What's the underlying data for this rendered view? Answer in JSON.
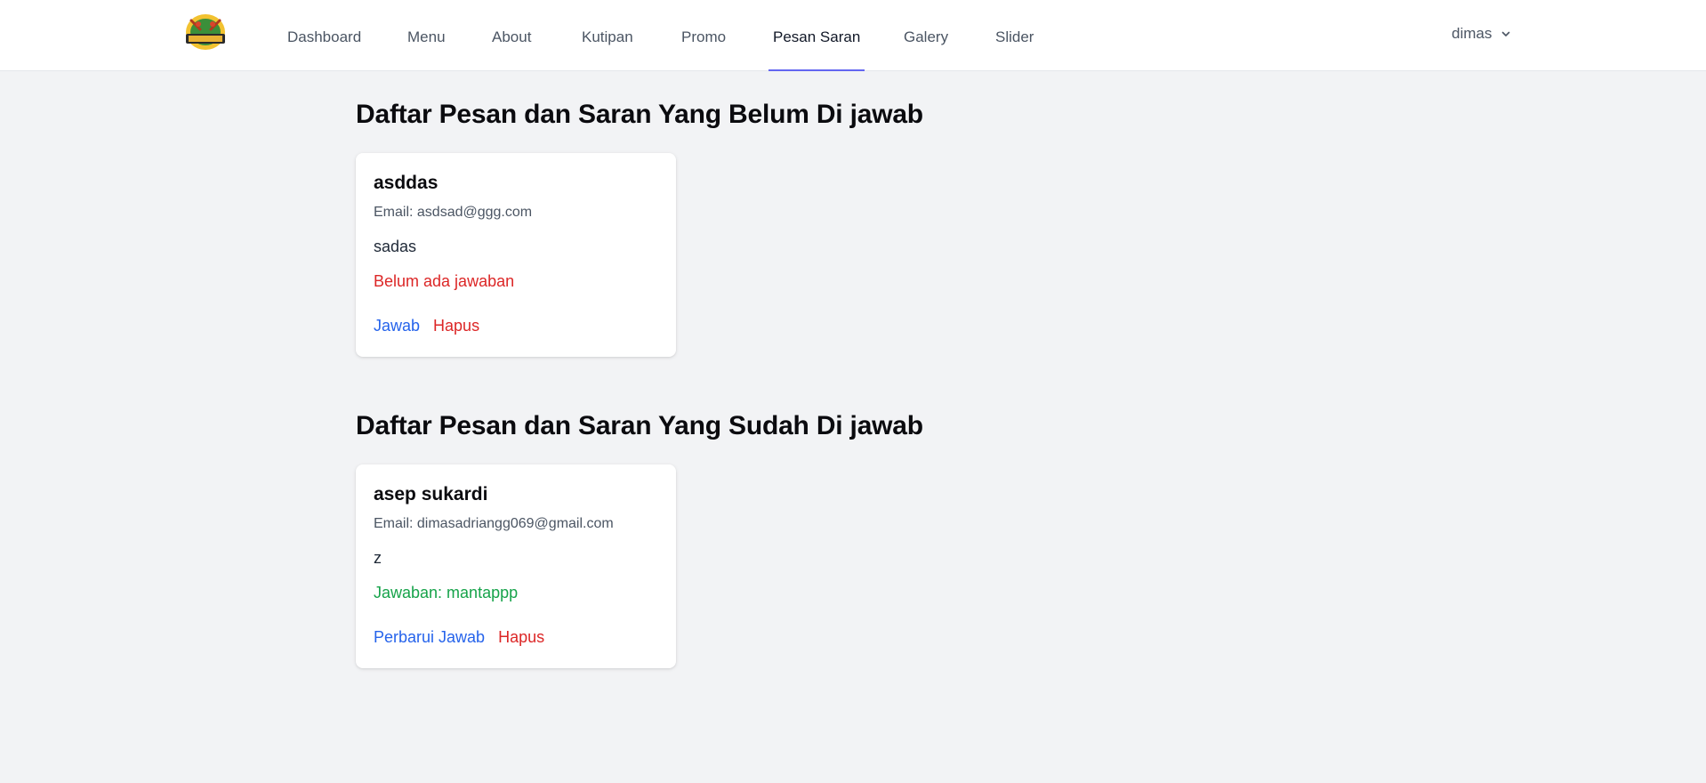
{
  "nav": {
    "items": [
      {
        "label": "Dashboard",
        "active": false
      },
      {
        "label": "Menu",
        "active": false
      },
      {
        "label": "About",
        "active": false
      },
      {
        "label": "Kutipan",
        "active": false
      },
      {
        "label": "Promo",
        "active": false
      },
      {
        "label": "Pesan Saran",
        "active": true
      },
      {
        "label": "Galery",
        "active": false
      },
      {
        "label": "Slider",
        "active": false
      }
    ],
    "user": "dimas"
  },
  "pending": {
    "title": "Daftar Pesan dan Saran Yang Belum Di jawab",
    "card": {
      "name": "asddas",
      "email": "Email: asdsad@ggg.com",
      "message": "sadas",
      "status": "Belum ada jawaban",
      "action_primary": "Jawab",
      "action_delete": "Hapus"
    }
  },
  "answered": {
    "title": "Daftar Pesan dan Saran Yang Sudah Di jawab",
    "card": {
      "name": "asep sukardi",
      "email": "Email: dimasadriangg069@gmail.com",
      "message": "z",
      "status": "Jawaban: mantappp",
      "action_primary": "Perbarui Jawab",
      "action_delete": "Hapus"
    }
  },
  "colors": {
    "accent": "#6366f1",
    "link_blue": "#2563eb",
    "danger_red": "#dc2626",
    "success_green": "#16a34a",
    "page_bg": "#f2f3f5"
  },
  "icons": {
    "logo": "restaurant-logo",
    "user_menu_caret": "chevron-down-icon"
  }
}
